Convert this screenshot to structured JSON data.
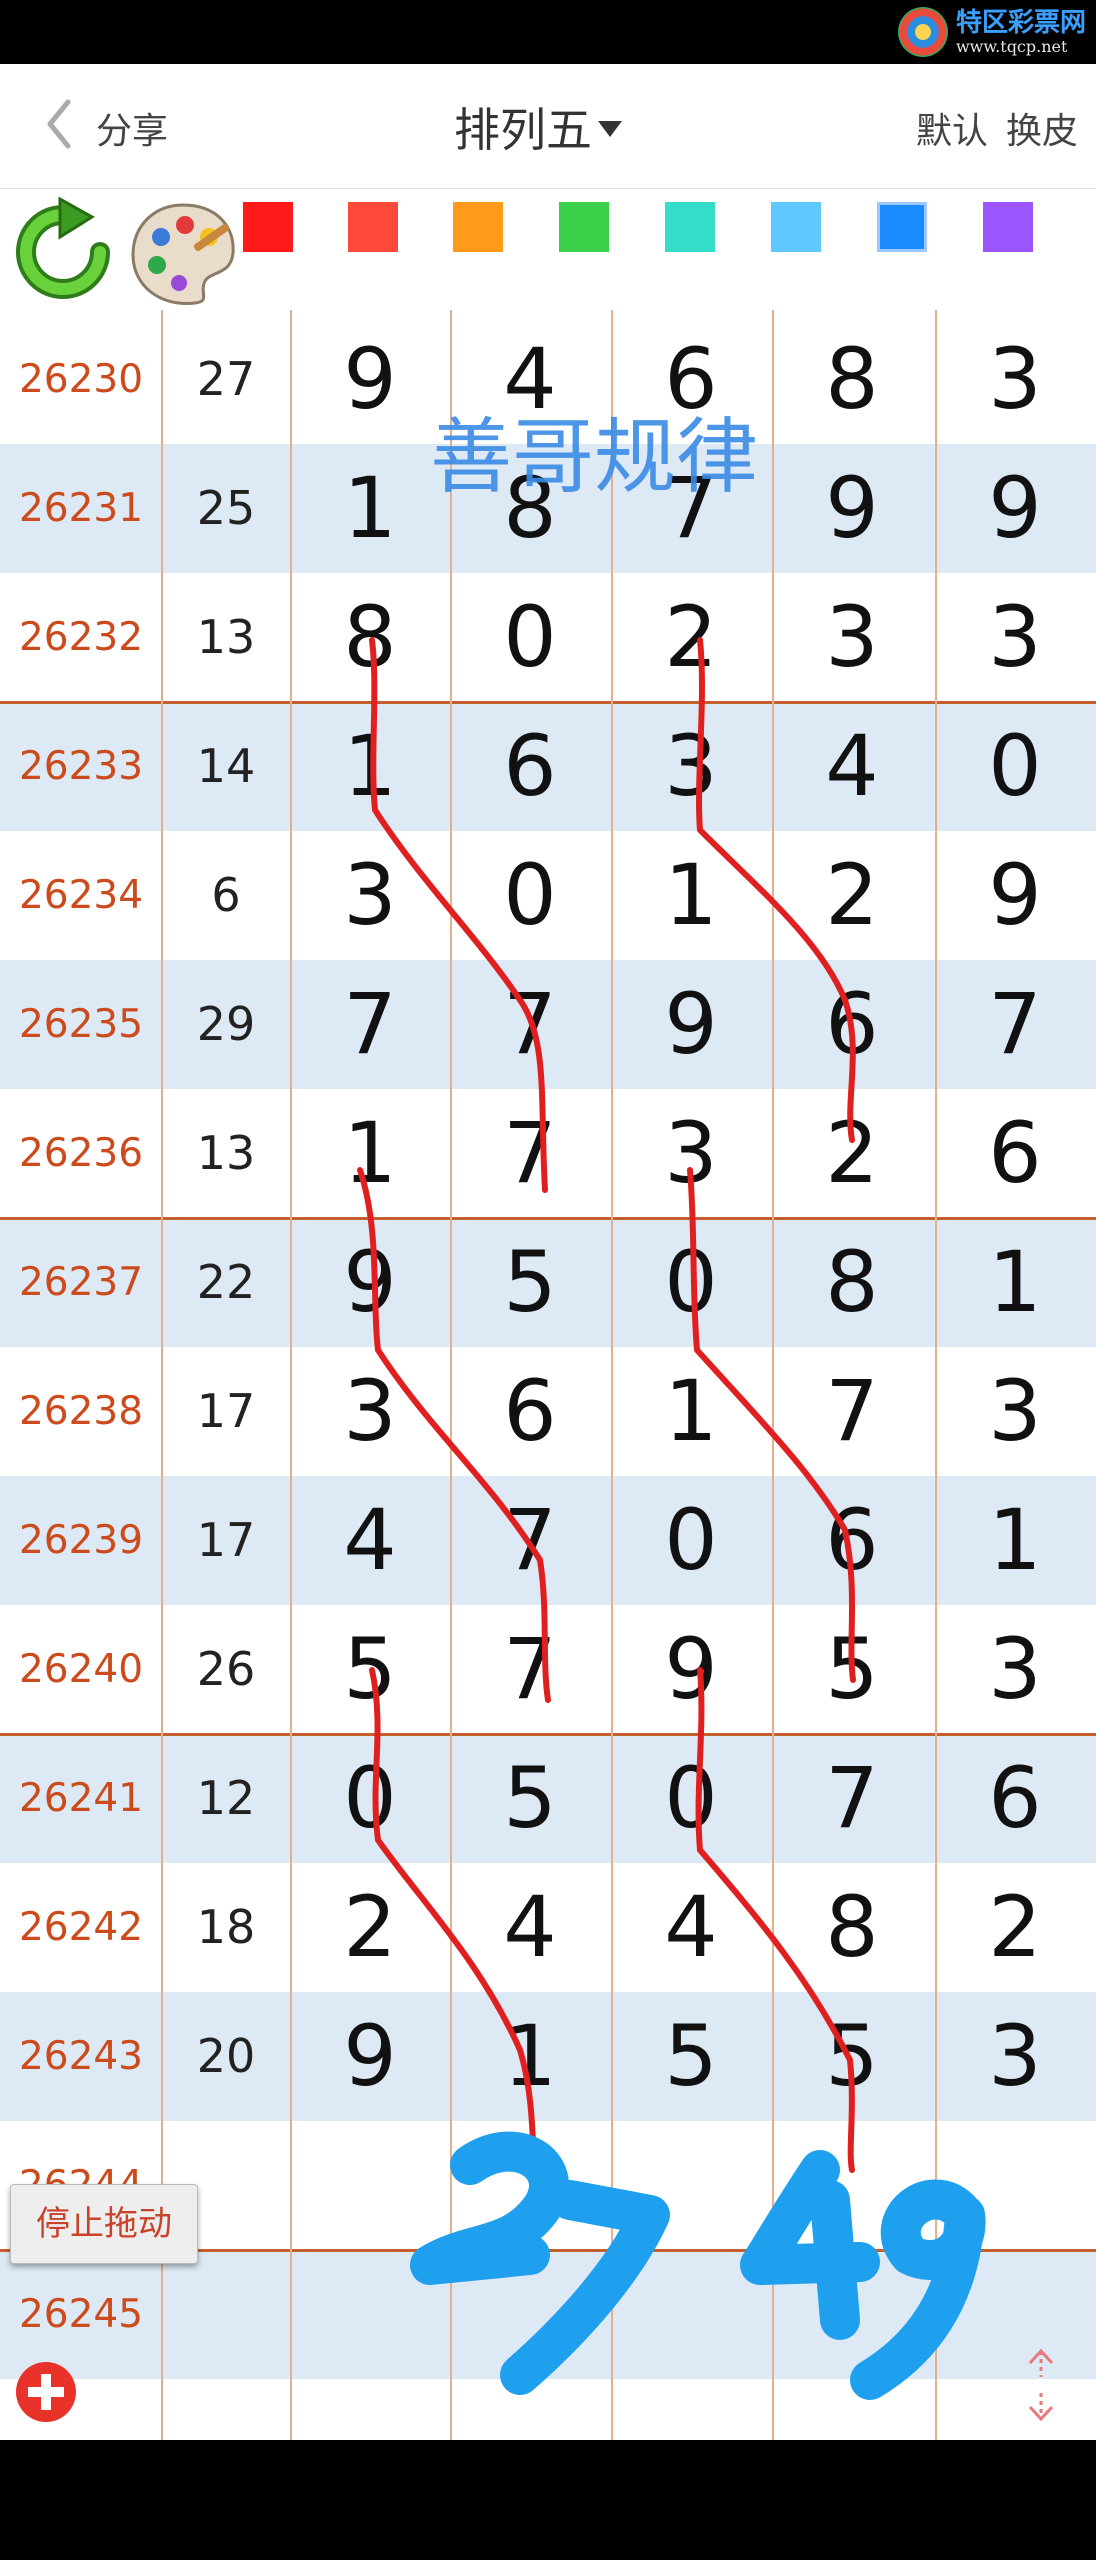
{
  "watermark": {
    "title": "特区彩票网",
    "url": "www.tqcp.net"
  },
  "nav": {
    "share": "分享",
    "title": "排列五",
    "default": "默认",
    "skin": "换皮"
  },
  "colors": {
    "swatches": [
      "#ff1a1a",
      "#ff4a3a",
      "#ff9a1a",
      "#3ad04a",
      "#35ddc8",
      "#5ec8ff",
      "#1a8cff",
      "#9a55ff"
    ]
  },
  "rows": [
    {
      "issue": "26230",
      "sum": "27",
      "digits": [
        "9",
        "4",
        "6",
        "8",
        "3"
      ]
    },
    {
      "issue": "26231",
      "sum": "25",
      "digits": [
        "1",
        "8",
        "7",
        "9",
        "9"
      ]
    },
    {
      "issue": "26232",
      "sum": "13",
      "digits": [
        "8",
        "0",
        "2",
        "3",
        "3"
      ]
    },
    {
      "issue": "26233",
      "sum": "14",
      "digits": [
        "1",
        "6",
        "3",
        "4",
        "0"
      ]
    },
    {
      "issue": "26234",
      "sum": "6",
      "digits": [
        "3",
        "0",
        "1",
        "2",
        "9"
      ]
    },
    {
      "issue": "26235",
      "sum": "29",
      "digits": [
        "7",
        "7",
        "9",
        "6",
        "7"
      ]
    },
    {
      "issue": "26236",
      "sum": "13",
      "digits": [
        "1",
        "7",
        "3",
        "2",
        "6"
      ]
    },
    {
      "issue": "26237",
      "sum": "22",
      "digits": [
        "9",
        "5",
        "0",
        "8",
        "1"
      ]
    },
    {
      "issue": "26238",
      "sum": "17",
      "digits": [
        "3",
        "6",
        "1",
        "7",
        "3"
      ]
    },
    {
      "issue": "26239",
      "sum": "17",
      "digits": [
        "4",
        "7",
        "0",
        "6",
        "1"
      ]
    },
    {
      "issue": "26240",
      "sum": "26",
      "digits": [
        "5",
        "7",
        "9",
        "5",
        "3"
      ]
    },
    {
      "issue": "26241",
      "sum": "12",
      "digits": [
        "0",
        "5",
        "0",
        "7",
        "6"
      ]
    },
    {
      "issue": "26242",
      "sum": "18",
      "digits": [
        "2",
        "4",
        "4",
        "8",
        "2"
      ]
    },
    {
      "issue": "26243",
      "sum": "20",
      "digits": [
        "9",
        "1",
        "5",
        "5",
        "3"
      ]
    },
    {
      "issue": "26244",
      "sum": "",
      "digits": [
        "",
        "",
        "",
        "",
        ""
      ]
    },
    {
      "issue": "26245",
      "sum": "",
      "digits": [
        "",
        "",
        "",
        "",
        ""
      ]
    }
  ],
  "overlay": {
    "label": "善哥规律",
    "num1": "27",
    "num2": "49"
  },
  "controls": {
    "stop_drag": "停止拖动"
  }
}
